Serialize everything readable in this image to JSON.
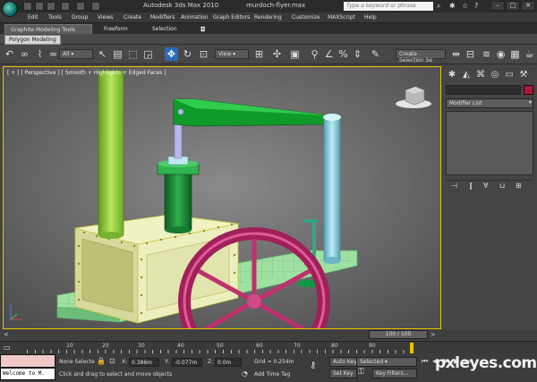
{
  "title_bar": {
    "app_title": "Autodesk 3ds Max  2010",
    "doc_title": "murdoch-flyer.max",
    "search_placeholder": "Type a keyword or phrase"
  },
  "menu": [
    "Edit",
    "Tools",
    "Group",
    "Views",
    "Create",
    "Modifiers",
    "Animation",
    "Graph Editors",
    "Rendering",
    "Customize",
    "MAXScript",
    "Help"
  ],
  "ribbon": {
    "tabs": [
      {
        "label": "Graphite Modeling Tools",
        "active": true
      },
      {
        "label": "Freeform",
        "active": false
      },
      {
        "label": "Selection",
        "active": false
      }
    ],
    "sub_tab": "Polygon Modeling"
  },
  "toolbar": {
    "filter_dropdown": "All",
    "refcoord_dropdown": "View",
    "named_selection": "Create Selection Se"
  },
  "viewport": {
    "label": "[ + ] [ Perspective ] [ Smooth + Highlights + Edged Faces ]"
  },
  "command_panel": {
    "modifier_list": "Modifier List",
    "object_color": "#b4143c"
  },
  "timeline": {
    "frame_counter": "100 / 100",
    "ticks": [
      "10",
      "20",
      "30",
      "40",
      "50",
      "60",
      "70",
      "80",
      "90"
    ]
  },
  "status": {
    "selection": "None Selecte",
    "x_label": "X:",
    "x_value": "0.386m",
    "y_label": "Y:",
    "y_value": "-0.077m",
    "z_label": "Z:",
    "z_value": "0.0m",
    "grid": "Grid = 0.254m",
    "prompt": "Click and drag to select and move objects",
    "add_time_tag": "Add Time Tag",
    "auto_key": "Auto Key",
    "selected_dropdown": "Selected",
    "set_key": "Set Key",
    "key_filters": "Key Filters...",
    "maxscript_output": "Welcome to M."
  },
  "watermark": "pxleyes.com",
  "colors": {
    "viewport_border": "#e6c400",
    "active_tool": "#2c6bb7",
    "funnel": "#9fd04a",
    "boiler": "#e6e8b8",
    "piston": "#1c8a3c",
    "column": "#8fd0e0",
    "wheel": "#c0306e",
    "base": "#9ee0a0"
  }
}
